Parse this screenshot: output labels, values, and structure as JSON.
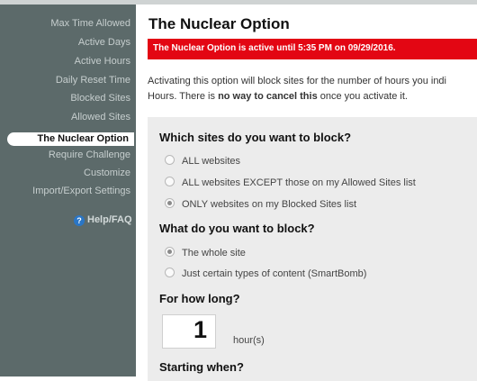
{
  "sidebar": {
    "items": [
      {
        "label": "Max Time Allowed"
      },
      {
        "label": "Active Days"
      },
      {
        "label": "Active Hours"
      },
      {
        "label": "Daily Reset Time"
      },
      {
        "label": "Blocked Sites"
      },
      {
        "label": "Allowed Sites"
      },
      {
        "label": "The Nuclear Option",
        "active": true
      },
      {
        "label": "Require Challenge"
      },
      {
        "label": "Customize"
      },
      {
        "label": "Import/Export Settings"
      }
    ],
    "help_label": "Help/FAQ",
    "help_icon": "question-circle-icon"
  },
  "main": {
    "title": "The Nuclear Option",
    "banner": "The Nuclear Option is active until 5:35 PM on 09/29/2016.",
    "banner_color": "#e30613",
    "description": {
      "line1": "Activating this option will block sites for the number of hours you indi",
      "line2_before": "Hours. There is ",
      "line2_bold": "no way to cancel this",
      "line2_after": " once you activate it."
    },
    "block_sites": {
      "heading": "Which sites do you want to block?",
      "options": [
        {
          "label": "ALL websites",
          "selected": false
        },
        {
          "label": "ALL websites EXCEPT those on my Allowed Sites list",
          "selected": false
        },
        {
          "label": "ONLY websites on my Blocked Sites list",
          "selected": true
        }
      ]
    },
    "block_what": {
      "heading": "What do you want to block?",
      "options": [
        {
          "label": "The whole site",
          "selected": true
        },
        {
          "label": "Just certain types of content (SmartBomb)",
          "selected": false
        }
      ]
    },
    "duration": {
      "heading": "For how long?",
      "value": "1",
      "unit": "hour(s)"
    },
    "start": {
      "heading": "Starting when?"
    }
  }
}
